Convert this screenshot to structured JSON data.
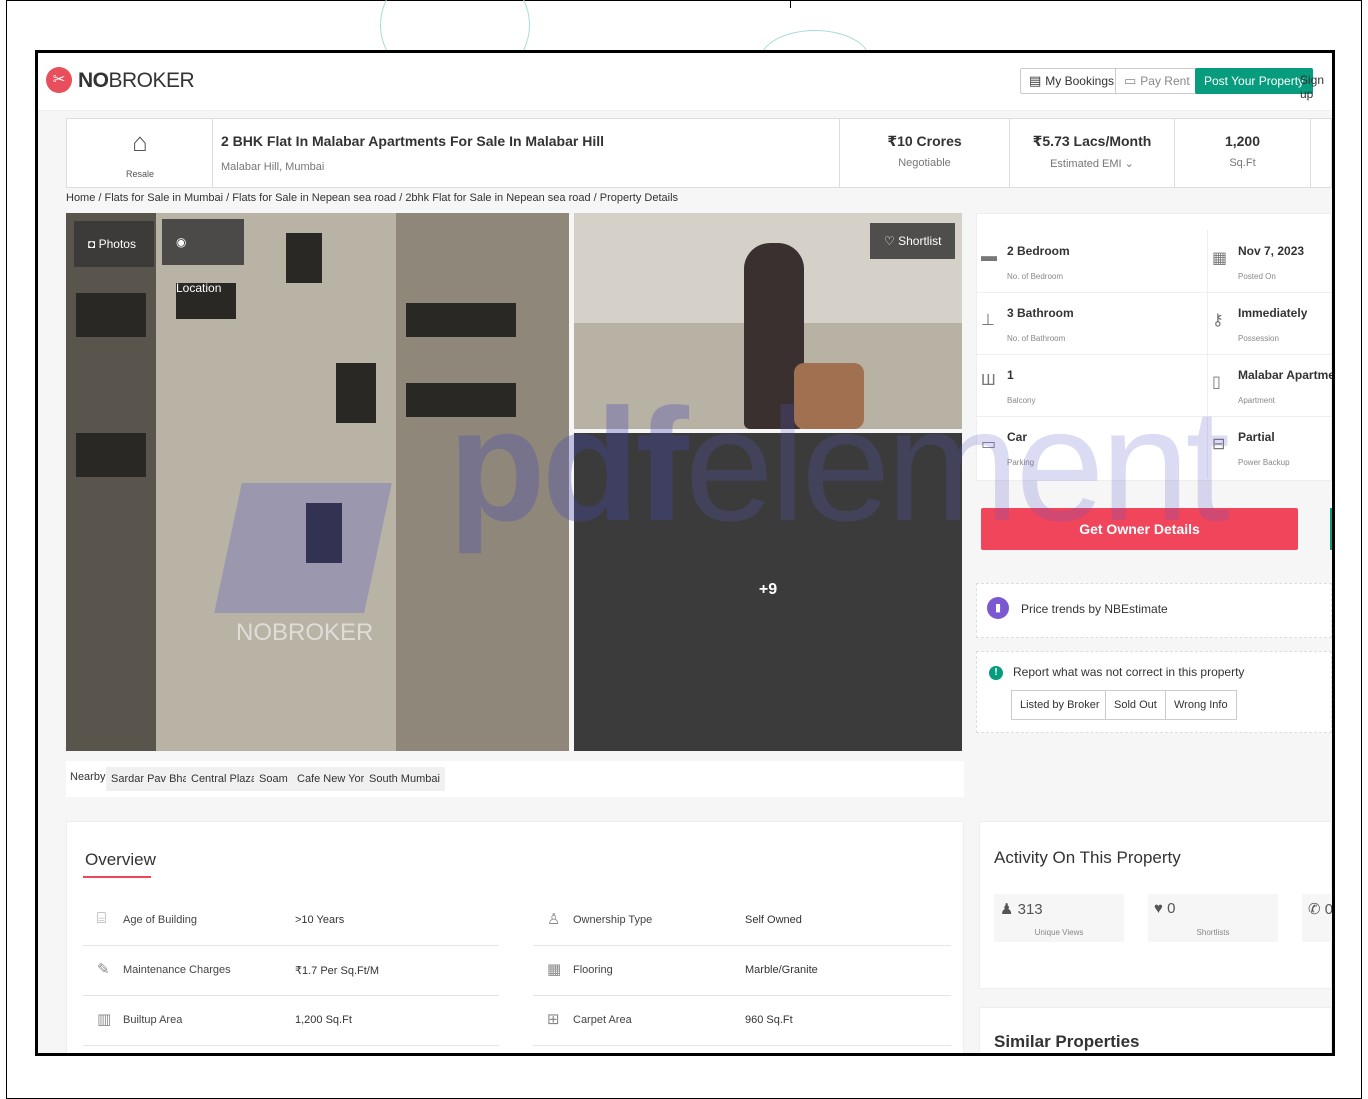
{
  "header": {
    "logo_brand_bold": "NO",
    "logo_brand_rest": "BROKER",
    "my_bookings": "My Bookings",
    "pay_rent": "Pay Rent",
    "post_property": "Post Your Property",
    "sign_up": "Sign up"
  },
  "title_bar": {
    "badge": "Resale",
    "title": "2 BHK Flat In Malabar Apartments For Sale In Malabar Hill",
    "location": "Malabar Hill, Mumbai",
    "price": "₹10 Crores",
    "price_label": "Negotiable",
    "emi": "₹5.73 Lacs/Month",
    "emi_label": "Estimated EMI ⌄",
    "area": "1,200",
    "area_label": "Sq.Ft"
  },
  "breadcrumb": "Home / Flats for Sale in Mumbai / Flats for Sale in Nepean sea road / 2bhk Flat for Sale in Nepean sea road / Property Details",
  "gallery": {
    "photos_label": "Photos",
    "location_label": "Location",
    "shortlist_label": "Shortlist",
    "more_count": "+9",
    "photo_watermark": "NOBROKER"
  },
  "facts": [
    {
      "value": "2 Bedroom",
      "label": "No. of Bedroom",
      "icon": "bed-icon"
    },
    {
      "value": "Nov 7, 2023",
      "label": "Posted On",
      "icon": "calendar-icon"
    },
    {
      "value": "3 Bathroom",
      "label": "No. of Bathroom",
      "icon": "bath-icon"
    },
    {
      "value": "Immediately",
      "label": "Possession",
      "icon": "key-icon"
    },
    {
      "value": "1",
      "label": "Balcony",
      "icon": "balcony-icon"
    },
    {
      "value": "Malabar Apartments",
      "label": "Apartment",
      "icon": "building-icon"
    },
    {
      "value": "Car",
      "label": "Parking",
      "icon": "car-icon"
    },
    {
      "value": "Partial",
      "label": "Power Backup",
      "icon": "battery-icon"
    }
  ],
  "owner_button": "Get Owner Details",
  "trends": "Price trends by NBEstimate",
  "report": {
    "text": "Report what was not correct in this property",
    "options": [
      "Listed by Broker",
      "Sold Out",
      "Wrong Info"
    ]
  },
  "nearby": {
    "label": "Nearby:",
    "items": [
      "Sardar Pav Bhaji",
      "Central Plaza",
      "Soam",
      "Cafe New York",
      "South Mumbai"
    ]
  },
  "overview": {
    "title": "Overview",
    "rows": [
      {
        "key": "Age of Building",
        "value": ">10 Years"
      },
      {
        "key": "Ownership Type",
        "value": "Self Owned"
      },
      {
        "key": "Maintenance Charges",
        "value": "₹1.7 Per Sq.Ft/M"
      },
      {
        "key": "Flooring",
        "value": "Marble/Granite"
      },
      {
        "key": "Builtup Area",
        "value": "1,200 Sq.Ft"
      },
      {
        "key": "Carpet Area",
        "value": "960 Sq.Ft"
      }
    ]
  },
  "activity": {
    "title": "Activity On This Property",
    "cards": [
      {
        "value": "313",
        "label": "Unique Views"
      },
      {
        "value": "0",
        "label": "Shortlists"
      },
      {
        "value": "0",
        "label": ""
      }
    ]
  },
  "similar_title": "Similar Properties",
  "watermark": {
    "part1": "pdf",
    "part2": "element"
  }
}
